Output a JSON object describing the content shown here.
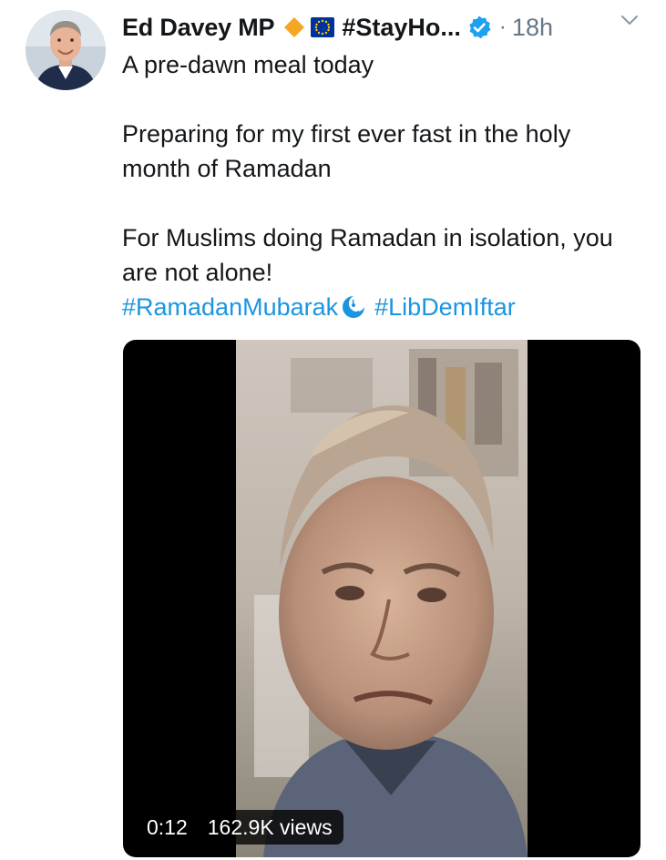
{
  "tweet": {
    "author_name": "Ed Davey MP",
    "name_hashtag": "#StayHo...",
    "time_separator": "·",
    "time": "18h",
    "icons": {
      "avatar": "avatar-photo",
      "diamond": "orange-diamond-icon",
      "eu_flag": "eu-flag-icon",
      "verified": "verified-badge-icon",
      "caret": "chevron-down-icon",
      "ramadan": "ramadan-crescent-icon"
    },
    "text_line1": "A pre-dawn meal today",
    "text_para2": "Preparing for my first ever fast in the holy month of Ramadan",
    "text_para3": "For Muslims doing Ramadan in isolation, you are not alone!",
    "hashtag1": "#RamadanMubarak",
    "hashtag2": "#LibDemIftar"
  },
  "video": {
    "duration": "0:12",
    "views": "162.9K views"
  },
  "colors": {
    "text": "#14171a",
    "muted": "#657786",
    "link": "#1b95e0",
    "verified": "#1da1f2",
    "diamond": "#f5a623",
    "eu_blue": "#003399",
    "eu_star": "#ffcc00"
  }
}
